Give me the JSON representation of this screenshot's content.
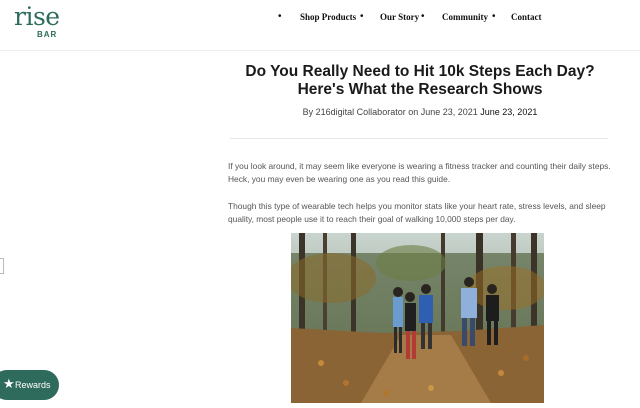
{
  "brand": {
    "logo_word": "rise",
    "logo_sub": "BAR",
    "color": "#2f6b5c"
  },
  "nav": {
    "bullet": "•",
    "items": [
      {
        "label": "Shop Products"
      },
      {
        "label": "Our Story"
      },
      {
        "label": "Community"
      },
      {
        "label": "Contact"
      }
    ]
  },
  "article": {
    "title": "Do You Really Need to Hit 10k Steps Each Day? Here's What the Research Shows",
    "byline_prefix": "By 216digital Collaborator on June 23, 2021",
    "byline_date": "June 23, 2021",
    "paragraphs": [
      "If you look around, it may seem like everyone is wearing a fitness tracker and counting their daily steps. Heck, you may even be wearing one as you read this guide.",
      "Though this type of wearable tech helps you monitor stats like your heart rate, stress levels, and sleep quality, most people use it to reach their goal of walking 10,000 steps per day."
    ]
  },
  "rewards": {
    "label": "Rewards",
    "icon": "star-icon"
  }
}
